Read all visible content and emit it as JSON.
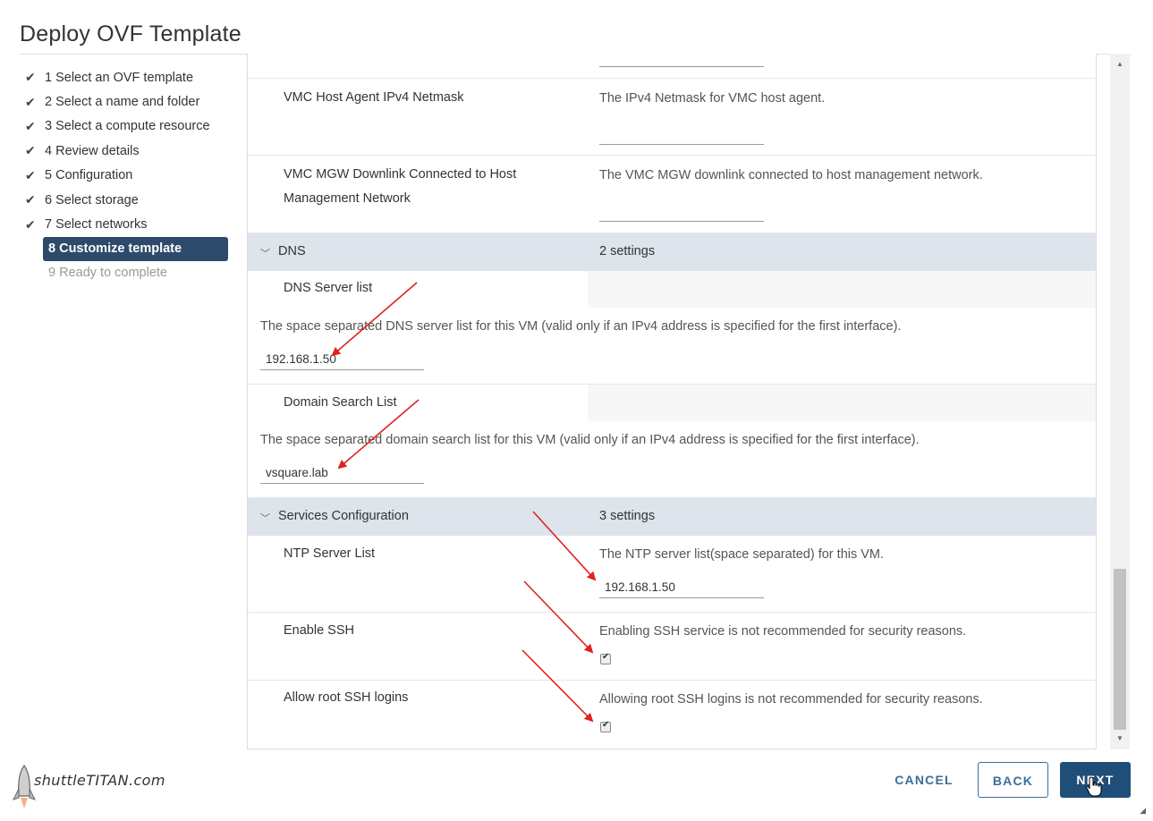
{
  "dialog": {
    "title": "Deploy OVF Template"
  },
  "steps": [
    {
      "label": "1 Select an OVF template",
      "state": "done"
    },
    {
      "label": "2 Select a name and folder",
      "state": "done"
    },
    {
      "label": "3 Select a compute resource",
      "state": "done"
    },
    {
      "label": "4 Review details",
      "state": "done"
    },
    {
      "label": "5 Configuration",
      "state": "done"
    },
    {
      "label": "6 Select storage",
      "state": "done"
    },
    {
      "label": "7 Select networks",
      "state": "done"
    },
    {
      "label": "8 Customize template",
      "state": "active"
    },
    {
      "label": "9 Ready to complete",
      "state": "pending"
    }
  ],
  "properties": {
    "vmc_netmask": {
      "name": "VMC Host Agent IPv4 Netmask",
      "desc": "The IPv4 Netmask for VMC host agent."
    },
    "vmc_mgw": {
      "name_line1": "VMC MGW Downlink Connected to Host",
      "name_line2": "Management Network",
      "desc": "The VMC MGW downlink connected to host management network."
    }
  },
  "dns": {
    "section": "DNS",
    "count": "2 settings",
    "server_list": {
      "name": "DNS Server list",
      "desc": "The space separated DNS server list for this VM (valid only if an IPv4 address is specified for the first interface).",
      "value": "192.168.1.50"
    },
    "domain_search": {
      "name": "Domain Search List",
      "desc": "The space separated domain search list for this VM (valid only if an IPv4 address is specified for the first interface).",
      "value": "vsquare.lab"
    }
  },
  "services": {
    "section": "Services Configuration",
    "count": "3 settings",
    "ntp": {
      "name": "NTP Server List",
      "desc": "The NTP server list(space separated) for this VM.",
      "value": "192.168.1.50"
    },
    "ssh": {
      "name": "Enable SSH",
      "desc": "Enabling SSH service is not recommended for security reasons.",
      "checked": true
    },
    "root_ssh": {
      "name": "Allow root SSH logins",
      "desc": "Allowing root SSH logins is not recommended for security reasons.",
      "checked": true
    }
  },
  "footer": {
    "logo_text": "shuttleTITAN.com",
    "cancel": "CANCEL",
    "back": "BACK",
    "next": "NEXT"
  },
  "colors": {
    "active_step": "#2d4a6b",
    "section_header": "#dde4ec",
    "primary_button": "#1f4e79",
    "annotation_arrow": "#e02020"
  }
}
